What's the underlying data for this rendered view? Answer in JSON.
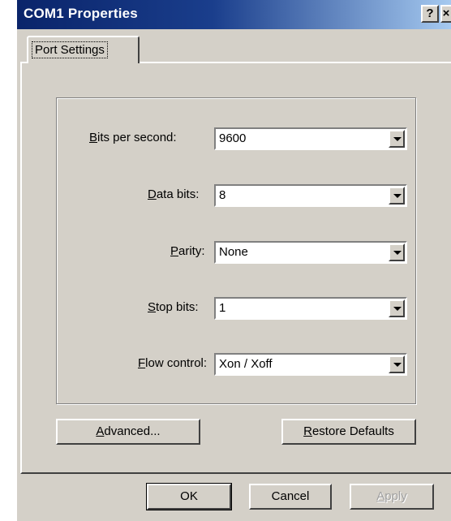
{
  "window": {
    "title": "COM1 Properties",
    "help_glyph": "?",
    "close_glyph": "×"
  },
  "tabs": [
    {
      "label": "Port Settings",
      "active": true
    }
  ],
  "fields": [
    {
      "label_key": "B",
      "label_rest": "its per second:",
      "value": "9600"
    },
    {
      "label_key": "D",
      "label_rest": "ata bits:",
      "value": "8"
    },
    {
      "label_key": "P",
      "label_rest": "arity:",
      "value": "None"
    },
    {
      "label_key": "S",
      "label_rest": "top bits:",
      "value": "1"
    },
    {
      "label_key": "F",
      "label_rest": "low control:",
      "value": "Xon / Xoff"
    }
  ],
  "buttons": {
    "advanced": {
      "key": "A",
      "rest": "dvanced..."
    },
    "restore": {
      "key": "R",
      "rest": "estore Defaults"
    },
    "ok": "OK",
    "cancel": "Cancel",
    "apply": {
      "key": "A",
      "rest": "pply",
      "enabled": false
    }
  },
  "colors": {
    "face": "#d4d0c8",
    "title_start": "#0a246a",
    "title_end": "#a6caf0"
  }
}
